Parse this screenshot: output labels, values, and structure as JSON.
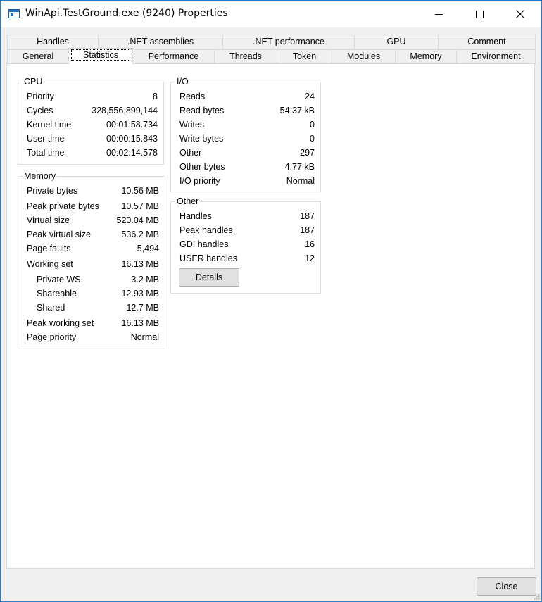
{
  "window": {
    "title": "WinApi.TestGround.exe (9240) Properties"
  },
  "tabs_top": [
    {
      "label": "Handles"
    },
    {
      "label": ".NET assemblies"
    },
    {
      "label": ".NET performance"
    },
    {
      "label": "GPU"
    },
    {
      "label": "Comment"
    }
  ],
  "tabs_bottom": [
    {
      "label": "General"
    },
    {
      "label": "Statistics",
      "selected": true
    },
    {
      "label": "Performance"
    },
    {
      "label": "Threads"
    },
    {
      "label": "Token"
    },
    {
      "label": "Modules"
    },
    {
      "label": "Memory"
    },
    {
      "label": "Environment"
    }
  ],
  "cpu": {
    "title": "CPU",
    "rows": [
      {
        "label": "Priority",
        "value": "8"
      },
      {
        "label": "Cycles",
        "value": "328,556,899,144"
      },
      {
        "label": "Kernel time",
        "value": "00:01:58.734"
      },
      {
        "label": "User time",
        "value": "00:00:15.843"
      },
      {
        "label": "Total time",
        "value": "00:02:14.578"
      }
    ]
  },
  "memory": {
    "title": "Memory",
    "rows": [
      {
        "label": "Private bytes",
        "value": "10.56 MB"
      },
      {
        "label": "Peak private bytes",
        "value": "10.57 MB"
      },
      {
        "label": "Virtual size",
        "value": "520.04 MB"
      },
      {
        "label": "Peak virtual size",
        "value": "536.2 MB"
      },
      {
        "label": "Page faults",
        "value": "5,494"
      },
      {
        "label": "Working set",
        "value": "16.13 MB"
      },
      {
        "label": "Private WS",
        "value": "3.2 MB"
      },
      {
        "label": "Shareable",
        "value": "12.93 MB"
      },
      {
        "label": "Shared",
        "value": "12.7 MB"
      },
      {
        "label": "Peak working set",
        "value": "16.13 MB"
      },
      {
        "label": "Page priority",
        "value": "Normal"
      }
    ]
  },
  "io": {
    "title": "I/O",
    "rows": [
      {
        "label": "Reads",
        "value": "24"
      },
      {
        "label": "Read bytes",
        "value": "54.37 kB"
      },
      {
        "label": "Writes",
        "value": "0"
      },
      {
        "label": "Write bytes",
        "value": "0"
      },
      {
        "label": "Other",
        "value": "297"
      },
      {
        "label": "Other bytes",
        "value": "4.77 kB"
      },
      {
        "label": "I/O priority",
        "value": "Normal"
      }
    ]
  },
  "other": {
    "title": "Other",
    "rows": [
      {
        "label": "Handles",
        "value": "187"
      },
      {
        "label": "Peak handles",
        "value": "187"
      },
      {
        "label": "GDI handles",
        "value": "16"
      },
      {
        "label": "USER handles",
        "value": "12"
      }
    ],
    "details_label": "Details"
  },
  "footer": {
    "close_label": "Close"
  },
  "icons": {
    "app": "app-window-icon",
    "minimize": "minimize-icon",
    "maximize": "maximize-icon",
    "close": "close-icon"
  }
}
